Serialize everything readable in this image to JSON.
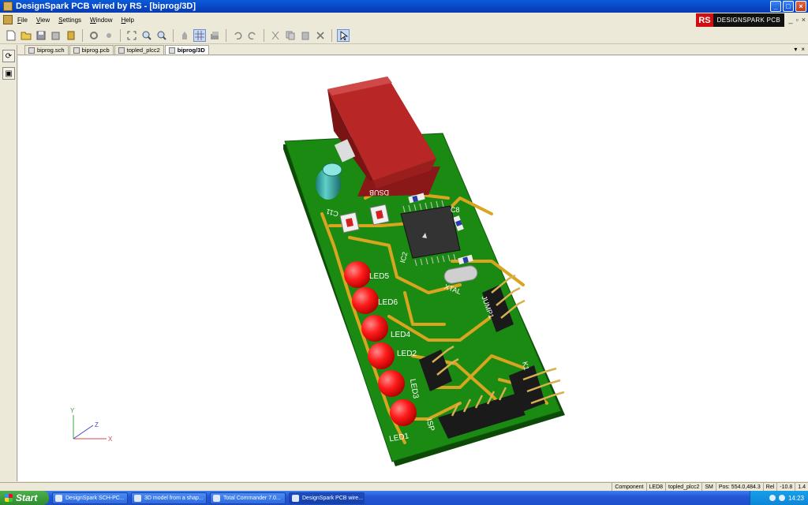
{
  "window": {
    "title": "DesignSpark PCB wired by RS - [biprog/3D]",
    "controls": [
      "_",
      "□",
      "×"
    ]
  },
  "menu": {
    "items": [
      {
        "key": "F",
        "rest": "ile"
      },
      {
        "key": "V",
        "rest": "iew"
      },
      {
        "key": "S",
        "rest": "ettings"
      },
      {
        "key": "W",
        "rest": "indow"
      },
      {
        "key": "H",
        "rest": "elp"
      }
    ],
    "logo_rs": "RS",
    "logo_text": "DESIGNSPARK PCB",
    "mdi_controls": [
      "_",
      "▫",
      "×"
    ]
  },
  "toolbar": {
    "icons": [
      "new-document-icon",
      "open-folder-icon",
      "save-icon",
      "save-all-icon",
      "library-icon",
      "sep",
      "settings-icon",
      "grid-settings-icon",
      "sep",
      "zoom-fit-icon",
      "zoom-in-icon",
      "zoom-out-icon",
      "sep",
      "pan-icon",
      "grid-toggle-icon",
      "layers-icon",
      "sep",
      "undo-icon",
      "redo-icon",
      "sep",
      "cut-icon",
      "copy-icon",
      "paste-icon",
      "delete-icon",
      "sep",
      "select-pointer-icon"
    ]
  },
  "tabs": [
    {
      "label": "biprog.sch",
      "active": false
    },
    {
      "label": "biprog.pcb",
      "active": false
    },
    {
      "label": "topled_plcc2",
      "active": false
    },
    {
      "label": "biprog/3D",
      "active": true
    }
  ],
  "tab_controls": [
    "▾",
    "×"
  ],
  "pcb": {
    "labels": {
      "dsub": "DSUB",
      "c11": "C11",
      "c8": "C8",
      "ic2": "IC2",
      "xtal": "XTAL",
      "jump1": "JUMP1",
      "led5": "LED5",
      "led6": "LED6",
      "led4": "LED4",
      "led2": "LED2",
      "led3": "LED3",
      "led1": "LED1",
      "isp": "ISP",
      "k1": "K1"
    },
    "colors": {
      "board": "#1a8a12",
      "trace": "#d9a520",
      "led": "#ff1a1a",
      "dsub": "#c43030",
      "cap": "#2aa39e"
    }
  },
  "axes": {
    "x": "X",
    "y": "Y",
    "z": "Z"
  },
  "status": {
    "mode": "Component",
    "component": "LED8",
    "footprint": "topled_plcc2",
    "units": "SM",
    "pos": "Pos: 554.0,484.3",
    "rel": "Rel",
    "rel_value": "-10.8",
    "rel_value2": "1.4"
  },
  "taskbar": {
    "start": "Start",
    "tasks": [
      {
        "label": "DesignSpark SCH-PC...",
        "active": false
      },
      {
        "label": "3D model from a shap...",
        "active": false
      },
      {
        "label": "Total Commander 7.0...",
        "active": false
      },
      {
        "label": "DesignSpark PCB wire...",
        "active": true
      }
    ],
    "clock": "14:23"
  }
}
